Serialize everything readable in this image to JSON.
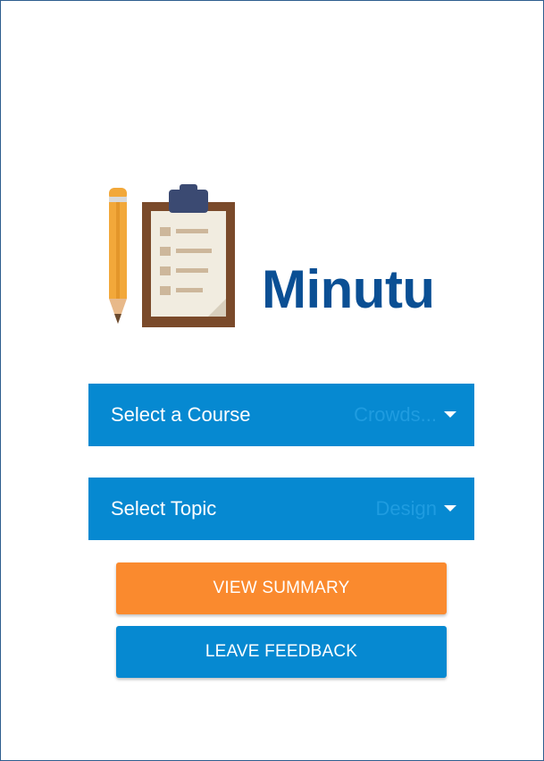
{
  "app": {
    "name": "Minutu"
  },
  "logo": {
    "icons": [
      "pencil-icon",
      "clipboard-icon"
    ],
    "colors": {
      "pencil_body": "#f2a83a",
      "pencil_tip": "#e8b98a",
      "clipboard_board": "#7a4a2a",
      "clipboard_clip": "#3b4a72",
      "paper": "#f1ece0",
      "paper_marks": "#cdb79b"
    }
  },
  "course_select": {
    "label": "Select a Course",
    "value": "Crowds..."
  },
  "topic_select": {
    "label": "Select Topic",
    "value": "Design"
  },
  "buttons": {
    "view_summary": "VIEW SUMMARY",
    "leave_feedback": "LEAVE FEEDBACK"
  },
  "colors": {
    "brand_blue": "#0a4f94",
    "select_blue": "#0689d1",
    "summary_orange": "#fa8a2e"
  }
}
